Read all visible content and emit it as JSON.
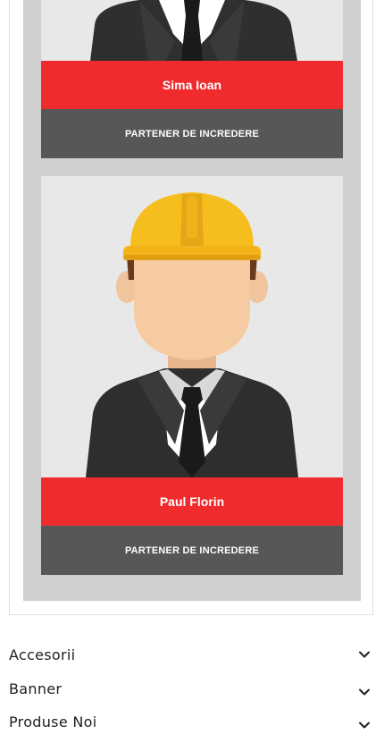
{
  "cards": [
    {
      "name": "Sima Ioan",
      "role": "PARTENER DE INCREDERE",
      "portrait_icon": "businessman-avatar-icon"
    },
    {
      "name": "Paul Florin",
      "role": "PARTENER DE INCREDERE",
      "portrait_icon": "engineer-hardhat-avatar-icon"
    }
  ],
  "accordion": [
    {
      "label": "Accesorii",
      "icon": "chevron-down-icon"
    },
    {
      "label": "Banner",
      "icon": "chevron-down-icon"
    },
    {
      "label": "Produse Noi",
      "icon": "chevron-down-icon"
    }
  ],
  "colors": {
    "accent_red": "#ef2b2d",
    "role_bar": "#575757",
    "panel_grey": "#cfcfcf",
    "card_bg": "#e8e8e8",
    "hardhat_yellow": "#f5be1e"
  }
}
